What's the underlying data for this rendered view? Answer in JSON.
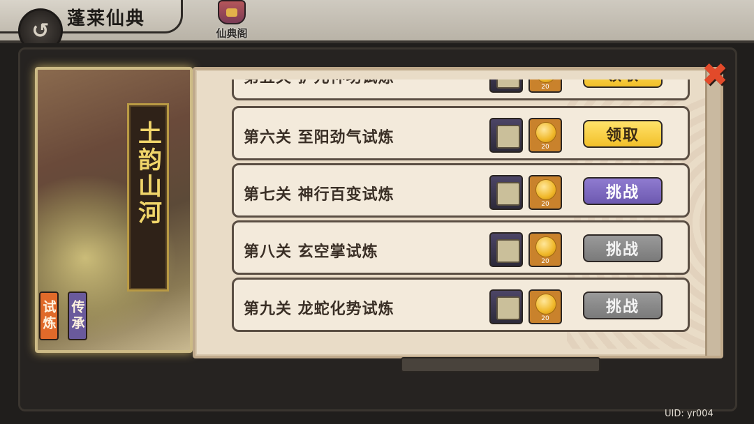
{
  "header": {
    "title": "蓬莱仙典",
    "back_icon": "back-swirl-icon",
    "tab_label": "仙典阁"
  },
  "scroll_card": {
    "name": "土韵山河",
    "tabs": [
      {
        "label": "试炼",
        "color": "#e06a2a"
      },
      {
        "label": "传承",
        "color": "#6a5a9c"
      }
    ]
  },
  "stages": [
    {
      "label": "第五关 护元神功试炼",
      "reward_qty": "20",
      "action": "领取",
      "state": "claim"
    },
    {
      "label": "第六关 至阳劲气试炼",
      "reward_qty": "20",
      "action": "领取",
      "state": "claim"
    },
    {
      "label": "第七关 神行百变试炼",
      "reward_qty": "20",
      "action": "挑战",
      "state": "challenge"
    },
    {
      "label": "第八关 玄空掌试炼",
      "reward_qty": "20",
      "action": "挑战",
      "state": "locked"
    },
    {
      "label": "第九关 龙蛇化势试炼",
      "reward_qty": "20",
      "action": "挑战",
      "state": "locked"
    }
  ],
  "footer": {
    "uid": "UID: yr004"
  }
}
